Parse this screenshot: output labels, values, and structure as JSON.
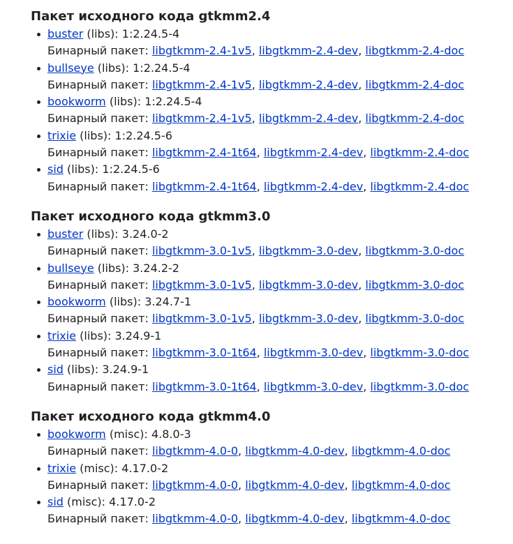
{
  "binary_label": "Бинарный пакет:",
  "sections": [
    {
      "title": "Пакет исходного кода gtkmm2.4",
      "items": [
        {
          "suite": "buster",
          "info": " (libs): 1:2.24.5-4",
          "packages": [
            "libgtkmm-2.4-1v5",
            "libgtkmm-2.4-dev",
            "libgtkmm-2.4-doc"
          ]
        },
        {
          "suite": "bullseye",
          "info": " (libs): 1:2.24.5-4",
          "packages": [
            "libgtkmm-2.4-1v5",
            "libgtkmm-2.4-dev",
            "libgtkmm-2.4-doc"
          ]
        },
        {
          "suite": "bookworm",
          "info": " (libs): 1:2.24.5-4",
          "packages": [
            "libgtkmm-2.4-1v5",
            "libgtkmm-2.4-dev",
            "libgtkmm-2.4-doc"
          ]
        },
        {
          "suite": "trixie",
          "info": " (libs): 1:2.24.5-6",
          "packages": [
            "libgtkmm-2.4-1t64",
            "libgtkmm-2.4-dev",
            "libgtkmm-2.4-doc"
          ]
        },
        {
          "suite": "sid",
          "info": " (libs): 1:2.24.5-6",
          "packages": [
            "libgtkmm-2.4-1t64",
            "libgtkmm-2.4-dev",
            "libgtkmm-2.4-doc"
          ]
        }
      ]
    },
    {
      "title": "Пакет исходного кода gtkmm3.0",
      "items": [
        {
          "suite": "buster",
          "info": " (libs): 3.24.0-2",
          "packages": [
            "libgtkmm-3.0-1v5",
            "libgtkmm-3.0-dev",
            "libgtkmm-3.0-doc"
          ]
        },
        {
          "suite": "bullseye",
          "info": " (libs): 3.24.2-2",
          "packages": [
            "libgtkmm-3.0-1v5",
            "libgtkmm-3.0-dev",
            "libgtkmm-3.0-doc"
          ]
        },
        {
          "suite": "bookworm",
          "info": " (libs): 3.24.7-1",
          "packages": [
            "libgtkmm-3.0-1v5",
            "libgtkmm-3.0-dev",
            "libgtkmm-3.0-doc"
          ]
        },
        {
          "suite": "trixie",
          "info": " (libs): 3.24.9-1",
          "packages": [
            "libgtkmm-3.0-1t64",
            "libgtkmm-3.0-dev",
            "libgtkmm-3.0-doc"
          ]
        },
        {
          "suite": "sid",
          "info": " (libs): 3.24.9-1",
          "packages": [
            "libgtkmm-3.0-1t64",
            "libgtkmm-3.0-dev",
            "libgtkmm-3.0-doc"
          ]
        }
      ]
    },
    {
      "title": "Пакет исходного кода gtkmm4.0",
      "items": [
        {
          "suite": "bookworm",
          "info": " (misc): 4.8.0-3",
          "packages": [
            "libgtkmm-4.0-0",
            "libgtkmm-4.0-dev",
            "libgtkmm-4.0-doc"
          ]
        },
        {
          "suite": "trixie",
          "info": " (misc): 4.17.0-2",
          "packages": [
            "libgtkmm-4.0-0",
            "libgtkmm-4.0-dev",
            "libgtkmm-4.0-doc"
          ]
        },
        {
          "suite": "sid",
          "info": " (misc): 4.17.0-2",
          "packages": [
            "libgtkmm-4.0-0",
            "libgtkmm-4.0-dev",
            "libgtkmm-4.0-doc"
          ]
        }
      ]
    }
  ]
}
